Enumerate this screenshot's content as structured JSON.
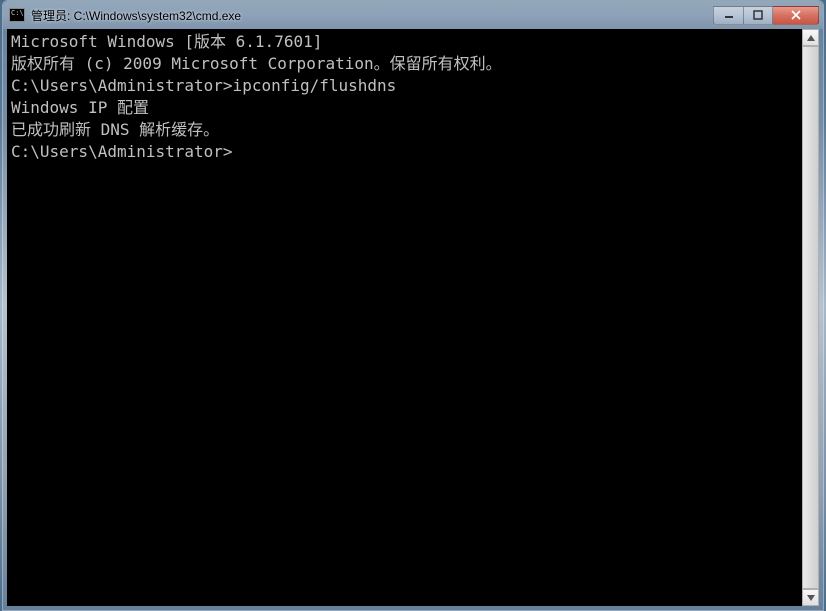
{
  "window": {
    "title": "管理员: C:\\Windows\\system32\\cmd.exe"
  },
  "terminal": {
    "line1": "Microsoft Windows [版本 6.1.7601]",
    "line2": "版权所有 (c) 2009 Microsoft Corporation。保留所有权利。",
    "blank1": "",
    "prompt1": "C:\\Users\\Administrator>ipconfig/flushdns",
    "blank2": "",
    "header": "Windows IP 配置",
    "blank3": "",
    "success": "已成功刷新 DNS 解析缓存。",
    "blank4": "",
    "prompt2": "C:\\Users\\Administrator>"
  }
}
